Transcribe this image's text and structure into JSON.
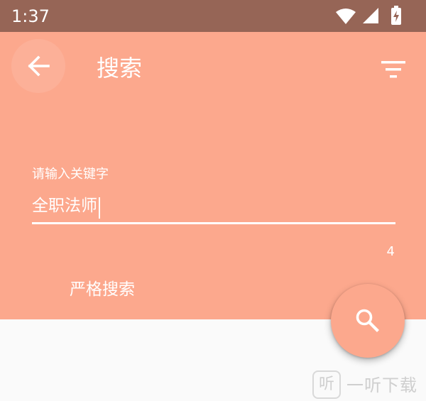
{
  "status_bar": {
    "time": "1:37",
    "icons": [
      "wifi-icon",
      "cellular-signal-icon",
      "battery-charging-icon"
    ]
  },
  "toolbar": {
    "back_icon": "arrow-back-icon",
    "title": "搜索",
    "filter_icon": "filter-icon"
  },
  "search_form": {
    "label": "请输入关键字",
    "value": "全职法师",
    "char_count": "4",
    "strict_label": "严格搜索"
  },
  "fab": {
    "icon": "search-icon"
  },
  "watermark": {
    "logo_text": "听",
    "text": "一听下载"
  },
  "colors": {
    "status_bar": "#966556",
    "primary": "#fca88d",
    "background": "#fafafa",
    "on_primary": "#ffffff"
  }
}
